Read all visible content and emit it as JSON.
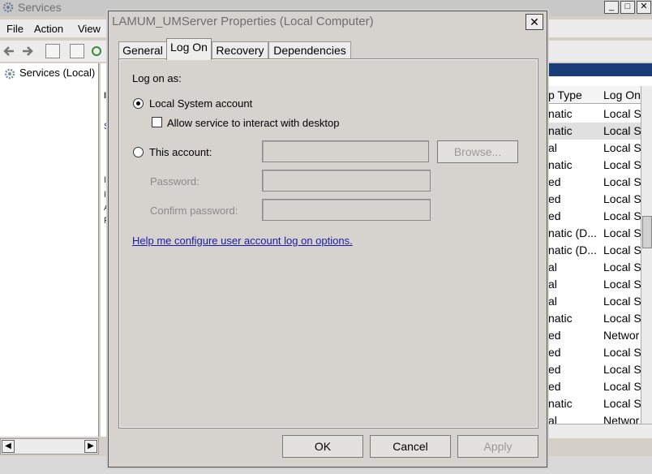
{
  "bg_window": {
    "title": "Services",
    "menu": [
      "File",
      "Action",
      "View"
    ],
    "tree_item": "Services (Local)",
    "middle_marks": [
      "I",
      "S",
      "I",
      "I",
      "A",
      "F"
    ],
    "column_headers": [
      "p Type",
      "Log On"
    ],
    "rows": [
      [
        "natic",
        "Local S"
      ],
      [
        "natic",
        "Local S"
      ],
      [
        "al",
        "Local S"
      ],
      [
        "natic",
        "Local S"
      ],
      [
        "ed",
        "Local S"
      ],
      [
        "ed",
        "Local S"
      ],
      [
        "ed",
        "Local S"
      ],
      [
        "natic (D...",
        "Local S"
      ],
      [
        "natic (D...",
        "Local S"
      ],
      [
        "al",
        "Local S"
      ],
      [
        "al",
        "Local S"
      ],
      [
        "al",
        "Local S"
      ],
      [
        "natic",
        "Local S"
      ],
      [
        "ed",
        "Networ"
      ],
      [
        "ed",
        "Local S"
      ],
      [
        "ed",
        "Local S"
      ],
      [
        "ed",
        "Local S"
      ],
      [
        "natic",
        "Local S"
      ],
      [
        "al",
        "Networ"
      ]
    ],
    "selected_row_index": 1
  },
  "dialog": {
    "title": "LAMUM_UMServer Properties (Local Computer)",
    "close_symbol": "✕",
    "tabs": [
      "General",
      "Log On",
      "Recovery",
      "Dependencies"
    ],
    "active_tab": "Log On",
    "log_on_as_label": "Log on as:",
    "local_system_label": "Local System account",
    "local_system_selected": true,
    "interact_desktop_label": "Allow service to interact with desktop",
    "interact_desktop_checked": false,
    "this_account_label": "This account:",
    "this_account_value": "",
    "browse_label": "Browse...",
    "password_label": "Password:",
    "password_value": "",
    "confirm_password_label": "Confirm password:",
    "confirm_password_value": "",
    "help_link": "Help me configure user account log on options.",
    "ok_label": "OK",
    "cancel_label": "Cancel",
    "apply_label": "Apply"
  },
  "colors": {
    "dialog_bg": "#d6d3ce",
    "link": "#1a1aa6",
    "header_strip": "#1a3d7a"
  }
}
